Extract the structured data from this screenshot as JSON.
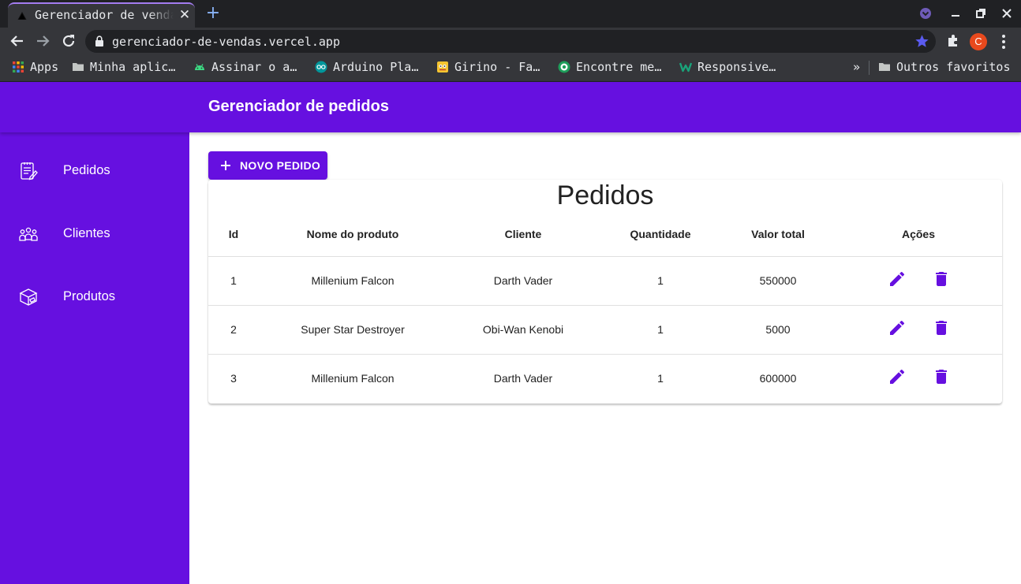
{
  "browser": {
    "tab_title": "Gerenciador de vendas",
    "url": "gerenciador-de-vendas.vercel.app",
    "bookmarks": [
      {
        "label": "Apps",
        "icon": "apps-grid-icon"
      },
      {
        "label": "Minha aplic…",
        "icon": "folder-icon"
      },
      {
        "label": "Assinar o a…",
        "icon": "android-icon"
      },
      {
        "label": "Arduino Pla…",
        "icon": "arduino-icon"
      },
      {
        "label": "Girino - Fa…",
        "icon": "girino-icon"
      },
      {
        "label": "Encontre me…",
        "icon": "target-icon"
      },
      {
        "label": "Responsive…",
        "icon": "w-logo-icon"
      }
    ],
    "overflow_label": "»",
    "other_bookmarks": "Outros favoritos",
    "profile_initial": "C"
  },
  "app": {
    "title": "Gerenciador de pedidos",
    "accent_color": "#6610e0",
    "sidebar": [
      {
        "label": "Pedidos",
        "icon": "orders-list-icon"
      },
      {
        "label": "Clientes",
        "icon": "customers-group-icon"
      },
      {
        "label": "Produtos",
        "icon": "products-box-icon"
      }
    ],
    "new_button_label": "NOVO PEDIDO"
  },
  "table": {
    "title": "Pedidos",
    "headers": [
      "Id",
      "Nome do produto",
      "Cliente",
      "Quantidade",
      "Valor total",
      "Ações"
    ],
    "rows": [
      [
        "1",
        "Millenium Falcon",
        "Darth Vader",
        "1",
        "550000"
      ],
      [
        "2",
        "Super Star Destroyer",
        "Obi-Wan Kenobi",
        "1",
        "5000"
      ],
      [
        "3",
        "Millenium Falcon",
        "Darth Vader",
        "1",
        "600000"
      ]
    ]
  }
}
